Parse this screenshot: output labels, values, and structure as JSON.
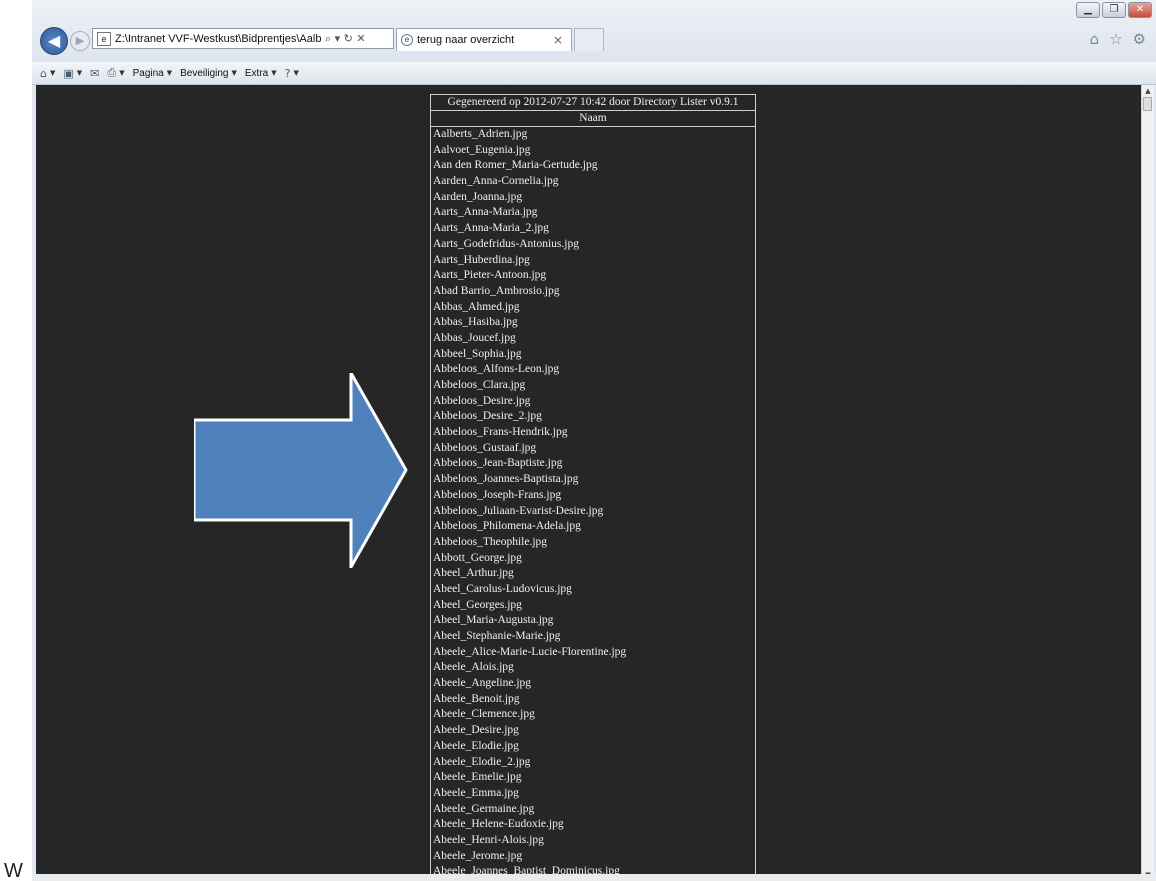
{
  "page_letter": "W",
  "browser": {
    "address": "Z:\\Intranet VVF-Westkust\\Bidprentjes\\Aalberts",
    "address_tools": "⌕ ▾ ↻ ✕",
    "tab_title": "terug naar overzicht",
    "tab_close": "×",
    "window_buttons": [
      "▁",
      "❐",
      "✕"
    ],
    "right_icons": [
      "⌂",
      "☆",
      "⚙"
    ]
  },
  "commandbar": {
    "pagina": "Pagina",
    "beveiliging": "Beveiliging",
    "extra": "Extra"
  },
  "listing": {
    "header": "Gegenereerd op 2012-07-27 10:42 door Directory Lister v0.9.1",
    "column": "Naam",
    "files": [
      "Aalberts_Adrien.jpg",
      "Aalvoet_Eugenia.jpg",
      "Aan den Romer_Maria-Gertude.jpg",
      "Aarden_Anna-Cornelia.jpg",
      "Aarden_Joanna.jpg",
      "Aarts_Anna-Maria.jpg",
      "Aarts_Anna-Maria_2.jpg",
      "Aarts_Godefridus-Antonius.jpg",
      "Aarts_Huberdina.jpg",
      "Aarts_Pieter-Antoon.jpg",
      "Abad Barrio_Ambrosio.jpg",
      "Abbas_Ahmed.jpg",
      "Abbas_Hasiba.jpg",
      "Abbas_Joucef.jpg",
      "Abbeel_Sophia.jpg",
      "Abbeloos_Alfons-Leon.jpg",
      "Abbeloos_Clara.jpg",
      "Abbeloos_Desire.jpg",
      "Abbeloos_Desire_2.jpg",
      "Abbeloos_Frans-Hendrik.jpg",
      "Abbeloos_Gustaaf.jpg",
      "Abbeloos_Jean-Baptiste.jpg",
      "Abbeloos_Joannes-Baptista.jpg",
      "Abbeloos_Joseph-Frans.jpg",
      "Abbeloos_Juliaan-Evarist-Desire.jpg",
      "Abbeloos_Philomena-Adela.jpg",
      "Abbeloos_Theophile.jpg",
      "Abbott_George.jpg",
      "Abeel_Arthur.jpg",
      "Abeel_Carolus-Ludovicus.jpg",
      "Abeel_Georges.jpg",
      "Abeel_Maria-Augusta.jpg",
      "Abeel_Stephanie-Marie.jpg",
      "Abeele_Alice-Marie-Lucie-Florentine.jpg",
      "Abeele_Alois.jpg",
      "Abeele_Angeline.jpg",
      "Abeele_Benoit.jpg",
      "Abeele_Clemence.jpg",
      "Abeele_Desire.jpg",
      "Abeele_Elodie.jpg",
      "Abeele_Elodie_2.jpg",
      "Abeele_Emelie.jpg",
      "Abeele_Emma.jpg",
      "Abeele_Germaine.jpg",
      "Abeele_Helene-Eudoxie.jpg",
      "Abeele_Henri-Alois.jpg",
      "Abeele_Jerome.jpg",
      "Abeele_Joannes_Baptist_Dominicus.jpg"
    ]
  },
  "colors": {
    "page_background": "#262626",
    "text": "#f0f0f0",
    "arrow_fill": "#4f81bd"
  }
}
